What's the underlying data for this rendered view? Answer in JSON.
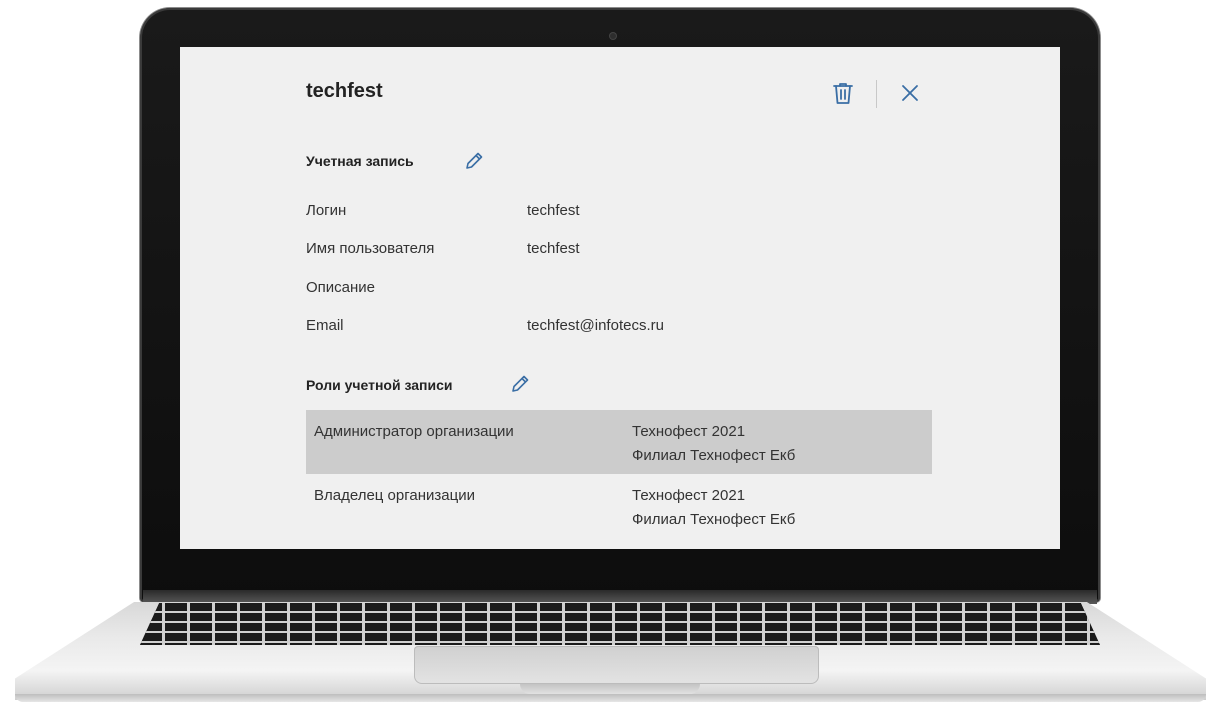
{
  "header": {
    "title": "techfest"
  },
  "account": {
    "section_title": "Учетная запись",
    "fields": [
      {
        "label": "Логин",
        "value": "techfest"
      },
      {
        "label": "Имя пользователя",
        "value": "techfest"
      },
      {
        "label": "Описание",
        "value": ""
      },
      {
        "label": "Email",
        "value": "techfest@infotecs.ru"
      }
    ]
  },
  "roles": {
    "section_title": "Роли учетной записи",
    "rows": [
      {
        "name": "Администратор организации",
        "orgs": [
          "Технофест 2021",
          "Филиал Технофест Екб"
        ],
        "selected": true
      },
      {
        "name": "Владелец организации",
        "orgs": [
          "Технофест 2021",
          "Филиал Технофест Екб"
        ],
        "selected": false
      }
    ]
  },
  "icons": {
    "delete": "trash-icon",
    "close": "close-icon",
    "edit": "pencil-icon"
  },
  "colors": {
    "accent": "#3a6ea5",
    "screen_bg": "#f0f0f0",
    "selected_row": "#cccccc"
  }
}
